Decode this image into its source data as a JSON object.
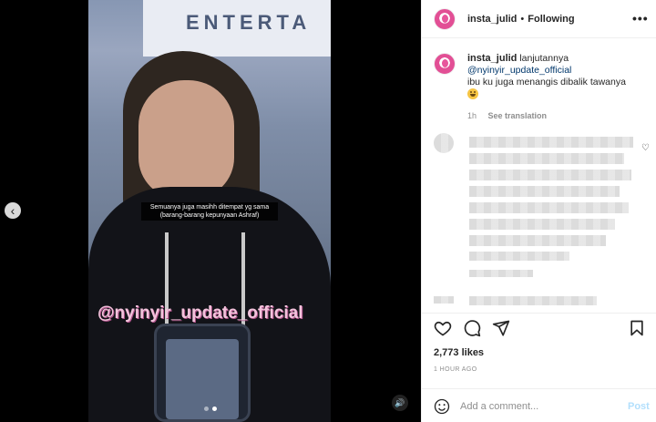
{
  "post": {
    "username": "insta_julid",
    "separator": "•",
    "follow_status": "Following",
    "more_icon": "more-horizontal-icon",
    "caption": {
      "username": "insta_julid",
      "text_1": "lanjutannya",
      "mention": "@nyinyir_update_official",
      "text_2": "ibu ku juga menangis dibalik tawanya",
      "emoji": "smiling-face-emoji"
    },
    "age": "1h",
    "see_translation": "See translation",
    "likes": "2,773 likes",
    "timestamp": "1 HOUR AGO",
    "comment_placeholder": "Add a comment...",
    "post_label": "Post"
  },
  "media": {
    "banner_text": "ENTERTA",
    "subtitle_line_1": "Semuanya juga masihh ditempat yg sama",
    "subtitle_line_2": "(barang-barang kepunyaan Ashraf)",
    "watermark": "@nyinyir_update_official",
    "carousel_count": 2,
    "carousel_active": 2
  },
  "colors": {
    "brand_avatar": "#e24f95",
    "link": "#00376b",
    "post_disabled": "#b2dffc",
    "muted": "#8e8e8e"
  }
}
